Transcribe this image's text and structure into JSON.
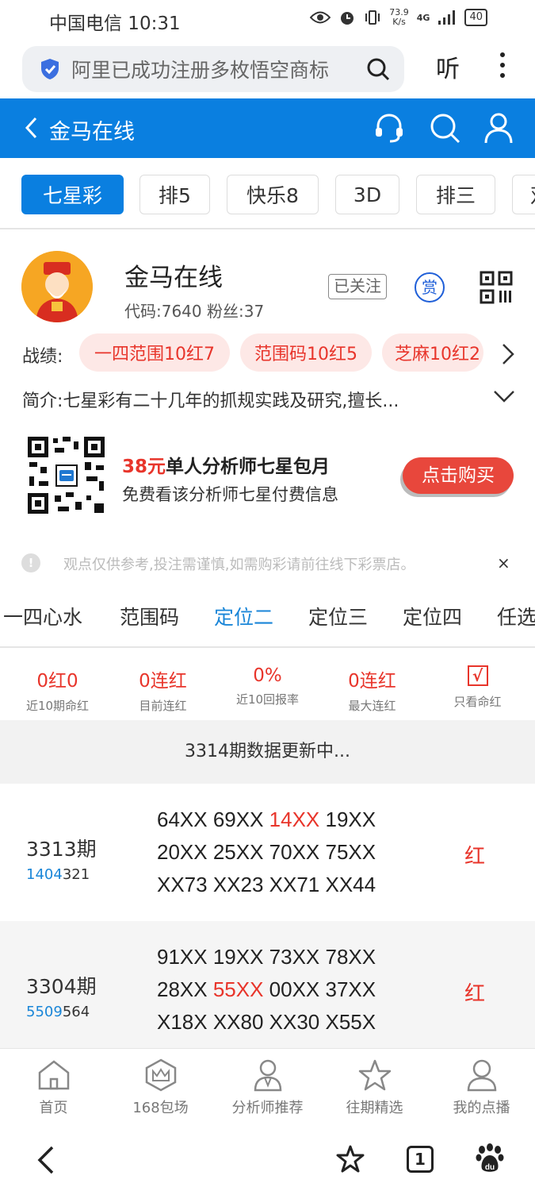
{
  "status_bar": {
    "carrier_time": "中国电信 10:31",
    "speed_value": "73.9",
    "speed_unit": "K/s",
    "network": "4G",
    "battery": "40"
  },
  "browser": {
    "search_text": "阿里已成功注册多枚悟空商标",
    "listen_label": "听"
  },
  "header": {
    "title": "金马在线"
  },
  "lottery_tabs": [
    {
      "label": "七星彩",
      "active": true
    },
    {
      "label": "排5"
    },
    {
      "label": "快乐8"
    },
    {
      "label": "3D"
    },
    {
      "label": "排三"
    },
    {
      "label": "双"
    }
  ],
  "profile": {
    "name": "金马在线",
    "meta": "代码:7640  粉丝:37",
    "follow_label": "已关注",
    "reward_label": "赏"
  },
  "record": {
    "label": "战绩:",
    "chips": [
      "一四范围10红7",
      "范围码10红5",
      "芝麻10红2"
    ]
  },
  "intro": {
    "text": "简介:七星彩有二十几年的抓规实践及研究,擅长..."
  },
  "promo": {
    "price": "38元",
    "title_rest": "单人分析师七星包月",
    "subtitle": "免费看该分析师七星付费信息",
    "buy_label": "点击购买"
  },
  "disclaimer": {
    "text": "观点仅供参考,投注需谨慎,如需购彩请前往线下彩票店。",
    "close": "×"
  },
  "category_tabs": [
    {
      "label": "一四心水"
    },
    {
      "label": "范围码"
    },
    {
      "label": "定位二",
      "active": true
    },
    {
      "label": "定位三"
    },
    {
      "label": "定位四"
    },
    {
      "label": "任选"
    }
  ],
  "stats": [
    {
      "value": "0红0",
      "label": "近10期命红"
    },
    {
      "value": "0连红",
      "label": "目前连红"
    },
    {
      "value": "0%",
      "label": "近10回报率"
    },
    {
      "value": "0连红",
      "label": "最大连红"
    },
    {
      "value": "√",
      "label": "只看命红"
    }
  ],
  "update_notice": "3314期数据更新中...",
  "records": [
    {
      "period": "3313期",
      "code_blue": "1404",
      "code_rest": "321",
      "lines": [
        [
          "64XX ",
          "69XX ",
          "14XX",
          " 19XX"
        ],
        [
          "20XX 25XX 70XX 75XX"
        ],
        [
          "XX73 XX23 XX71 XX44"
        ]
      ],
      "result": "红"
    },
    {
      "period": "3304期",
      "code_blue": "5509",
      "code_rest": "564",
      "lines": [
        [
          "91XX 19XX 73XX 78XX"
        ],
        [
          "28XX ",
          "55XX",
          " 00XX 37XX"
        ],
        [
          "X18X XX80 XX30 X55X"
        ]
      ],
      "result": "红"
    }
  ],
  "tabbar": [
    {
      "label": "首页",
      "icon": "home-icon"
    },
    {
      "label": "168包场",
      "icon": "crown-icon"
    },
    {
      "label": "分析师推荐",
      "icon": "analyst-icon"
    },
    {
      "label": "往期精选",
      "icon": "star-icon"
    },
    {
      "label": "我的点播",
      "icon": "user-icon"
    }
  ],
  "sysnav": {
    "tab_count": "1"
  },
  "colors": {
    "brand_blue": "#0a7fe0",
    "accent_red": "#e8352b",
    "chip_bg": "#fde8e6"
  }
}
